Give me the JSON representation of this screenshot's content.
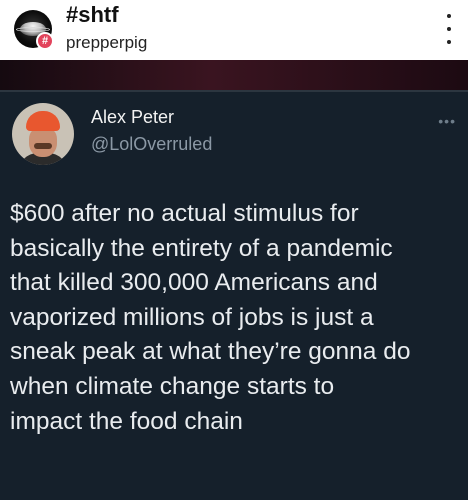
{
  "header": {
    "title": "#shtf",
    "subtitle": "prepperpig",
    "badge_glyph": "#",
    "avatar_icon": "planet-ring-icon",
    "more_icon": "vertical-dots-icon"
  },
  "tweet": {
    "author_name": "Alex Peter",
    "author_handle": "@LolOverruled",
    "more_icon": "horizontal-dots-icon",
    "more_glyph": "•••",
    "lines": [
      "$600 after no actual stimulus for",
      "basically the entirety of a pandemic",
      "that killed 300,000 Americans and",
      "vaporized millions of jobs is just a",
      "sneak peak at what they’re gonna do",
      "when climate change starts to",
      "impact the food chain"
    ]
  },
  "colors": {
    "tweet_background": "#15202b",
    "text_primary": "#e9ecef",
    "text_secondary": "#8b98a5",
    "badge": "#e2445c"
  }
}
